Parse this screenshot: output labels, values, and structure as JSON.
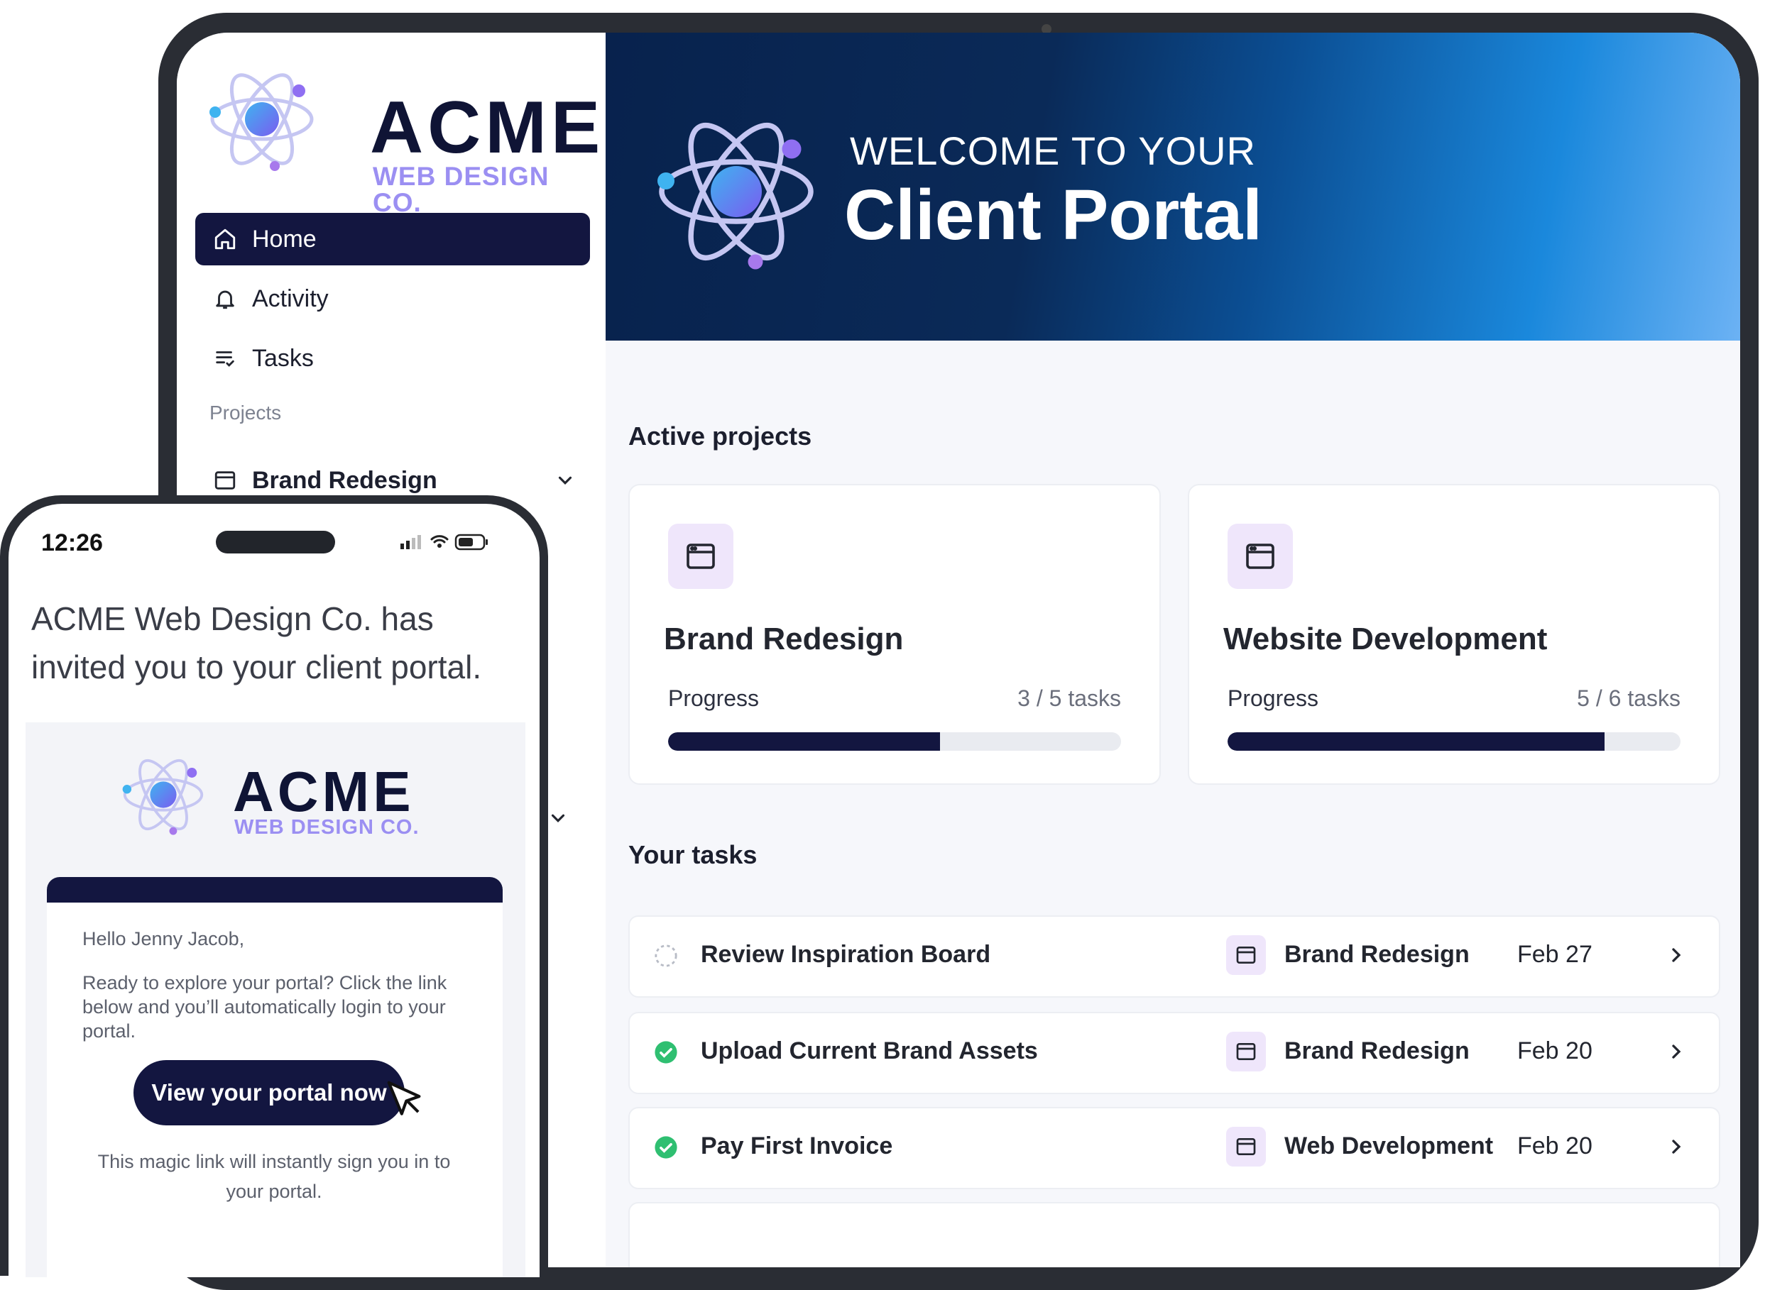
{
  "brand": {
    "name": "ACME",
    "sub": "WEB DESIGN CO."
  },
  "sidebar": {
    "items": [
      {
        "label": "Home",
        "icon": "home-icon",
        "active": true
      },
      {
        "label": "Activity",
        "icon": "bell-icon"
      },
      {
        "label": "Tasks",
        "icon": "tasks-icon"
      }
    ],
    "section_label": "Projects",
    "project": {
      "label": "Brand Redesign",
      "icon": "browser-window-icon"
    }
  },
  "hero": {
    "kicker": "WELCOME TO YOUR",
    "title": "Client Portal"
  },
  "active_projects": {
    "title": "Active projects",
    "items": [
      {
        "name": "Brand Redesign",
        "progress_label": "Progress",
        "count": "3 / 5 tasks",
        "progress": 0.6
      },
      {
        "name": "Website Development",
        "progress_label": "Progress",
        "count": "5 / 6 tasks",
        "progress": 0.833
      }
    ]
  },
  "tasks": {
    "title": "Your tasks",
    "items": [
      {
        "name": "Review Inspiration Board",
        "status": "pending",
        "project": "Brand Redesign",
        "date": "Feb 27"
      },
      {
        "name": "Upload Current Brand Assets",
        "status": "done",
        "project": "Brand Redesign",
        "date": "Feb 20"
      },
      {
        "name": "Pay First Invoice",
        "status": "done",
        "project": "Web Development",
        "date": "Feb 20"
      }
    ]
  },
  "phone": {
    "time": "12:26",
    "invite": "ACME Web Design Co. has invited you to your client portal.",
    "email": {
      "brand_name": "ACME",
      "brand_sub": "WEB DESIGN CO.",
      "greeting": "Hello Jenny Jacob,",
      "body": "Ready to explore your portal? Click the link below and you’ll automatically login to your portal.",
      "cta": "View your portal now",
      "footnote": "This magic link will instantly sign you in to your portal."
    }
  },
  "colors": {
    "navy": "#131640",
    "accent_purple": "#9b8ff2",
    "success": "#2fbf71",
    "icon_bg": "#efe6fb"
  }
}
